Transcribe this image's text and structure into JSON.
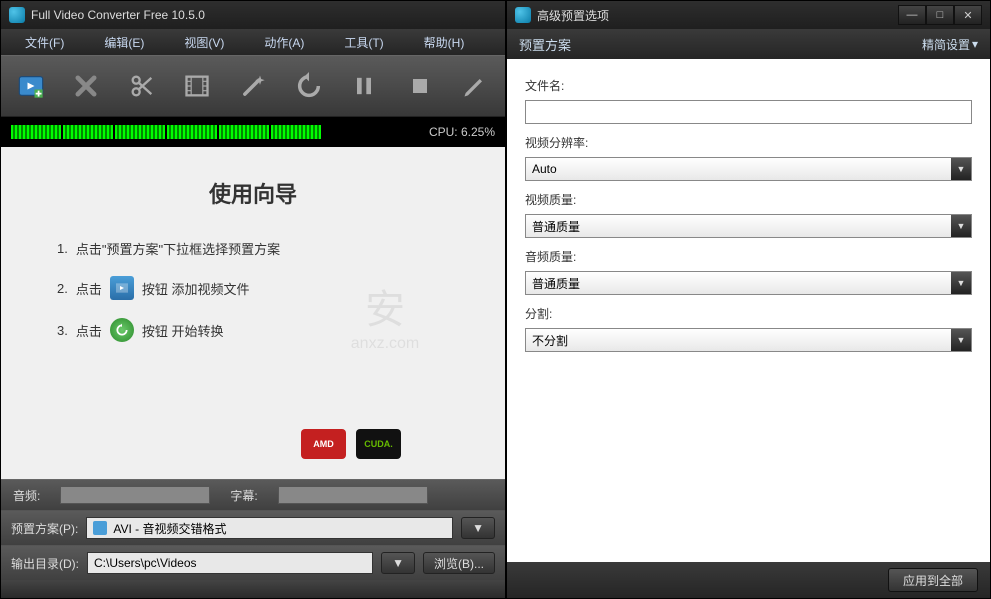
{
  "mainWindow": {
    "title": "Full Video Converter Free 10.5.0",
    "menus": [
      "文件(F)",
      "编辑(E)",
      "视图(V)",
      "动作(A)",
      "工具(T)",
      "帮助(H)"
    ],
    "cpuLabel": "CPU: 6.25%",
    "wizardTitle": "使用向导",
    "steps": {
      "s1_num": "1.",
      "s1_text": "点击\"预置方案\"下拉框选择预置方案",
      "s2_num": "2.",
      "s2_prefix": "点击",
      "s2_suffix": "按钮 添加视频文件",
      "s3_num": "3.",
      "s3_prefix": "点击",
      "s3_suffix": "按钮 开始转换"
    },
    "gpuBadges": {
      "amd": "AMD",
      "cuda": "CUDA."
    },
    "audioLabel": "音频:",
    "subtitleLabel": "字幕:",
    "presetLabel": "预置方案(P):",
    "presetValue": "AVI - 音视频交错格式",
    "outputLabel": "输出目录(D):",
    "outputValue": "C:\\Users\\pc\\Videos",
    "browseBtn": "浏览(B)..."
  },
  "dialog": {
    "title": "高级预置选项",
    "headerLabel": "预置方案",
    "settingsLink": "精简设置",
    "fields": {
      "filename_label": "文件名:",
      "filename_value": "",
      "resolution_label": "视频分辨率:",
      "resolution_value": "Auto",
      "vquality_label": "视频质量:",
      "vquality_value": "普通质量",
      "aquality_label": "音频质量:",
      "aquality_value": "普通质量",
      "split_label": "分割:",
      "split_value": "不分割"
    },
    "applyBtn": "应用到全部"
  },
  "watermark": {
    "line1": "安",
    "line2": "anxz.com"
  }
}
